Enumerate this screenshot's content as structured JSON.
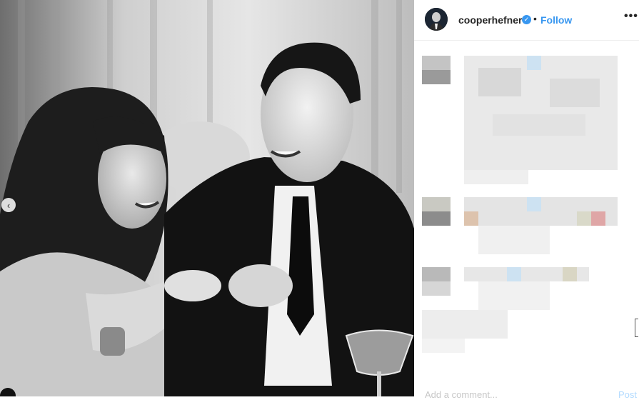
{
  "post": {
    "username": "cooperhefner",
    "verified_glyph": "✓",
    "separator": "•",
    "follow_label": "Follow",
    "more_label": "•••",
    "prev_glyph": "‹",
    "add_comment_placeholder": "Add a comment...",
    "post_label": "Post"
  },
  "icons": {
    "verified": "verified-badge-icon",
    "more": "more-options-icon",
    "prev": "chevron-left-icon"
  },
  "colors": {
    "link_blue": "#3897f0",
    "text": "#262626",
    "placeholder": "#c7c7c7"
  }
}
